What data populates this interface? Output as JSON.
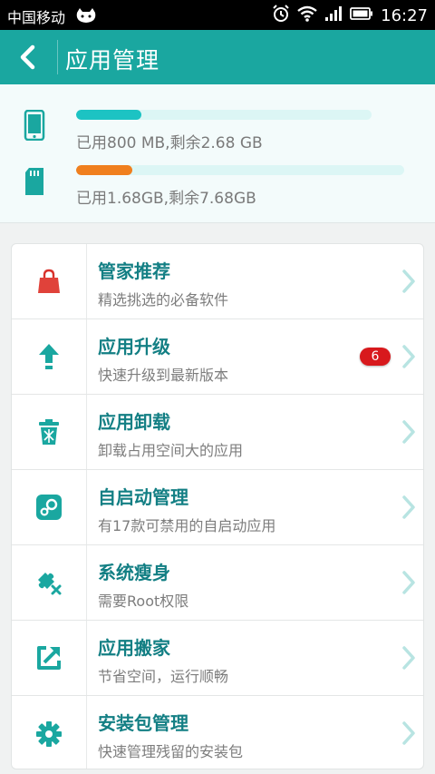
{
  "status_bar": {
    "carrier": "中国移动",
    "time": "16:27"
  },
  "app_bar": {
    "title": "应用管理"
  },
  "storage": {
    "phone": {
      "text": "已用800 MB,剩余2.68 GB",
      "used_fraction": 0.22,
      "color": "#1cc3c3"
    },
    "sdcard": {
      "text": "已用1.68GB,剩余7.68GB",
      "used_fraction": 0.17,
      "color": "#f07f1e"
    }
  },
  "menu": {
    "items": [
      {
        "title": "管家推荐",
        "subtitle": "精选挑选的必备软件",
        "icon": "shopping-bag-icon"
      },
      {
        "title": "应用升级",
        "subtitle": "快速升级到最新版本",
        "icon": "upgrade-arrow-icon",
        "badge": "6"
      },
      {
        "title": "应用卸载",
        "subtitle": "卸载占用空间大的应用",
        "icon": "trash-icon"
      },
      {
        "title": "自启动管理",
        "subtitle": "有17款可禁用的自启动应用",
        "icon": "startup-icon"
      },
      {
        "title": "系统瘦身",
        "subtitle": "需要Root权限",
        "icon": "puzzle-remove-icon"
      },
      {
        "title": "应用搬家",
        "subtitle": "节省空间，运行顺畅",
        "icon": "move-app-icon"
      },
      {
        "title": "安装包管理",
        "subtitle": "快速管理残留的安装包",
        "icon": "gear-icon"
      }
    ]
  },
  "colors": {
    "accent": "#1aa7a0",
    "title_text": "#137f84",
    "icon": "#1aa7a0",
    "badge": "#d8191d"
  }
}
